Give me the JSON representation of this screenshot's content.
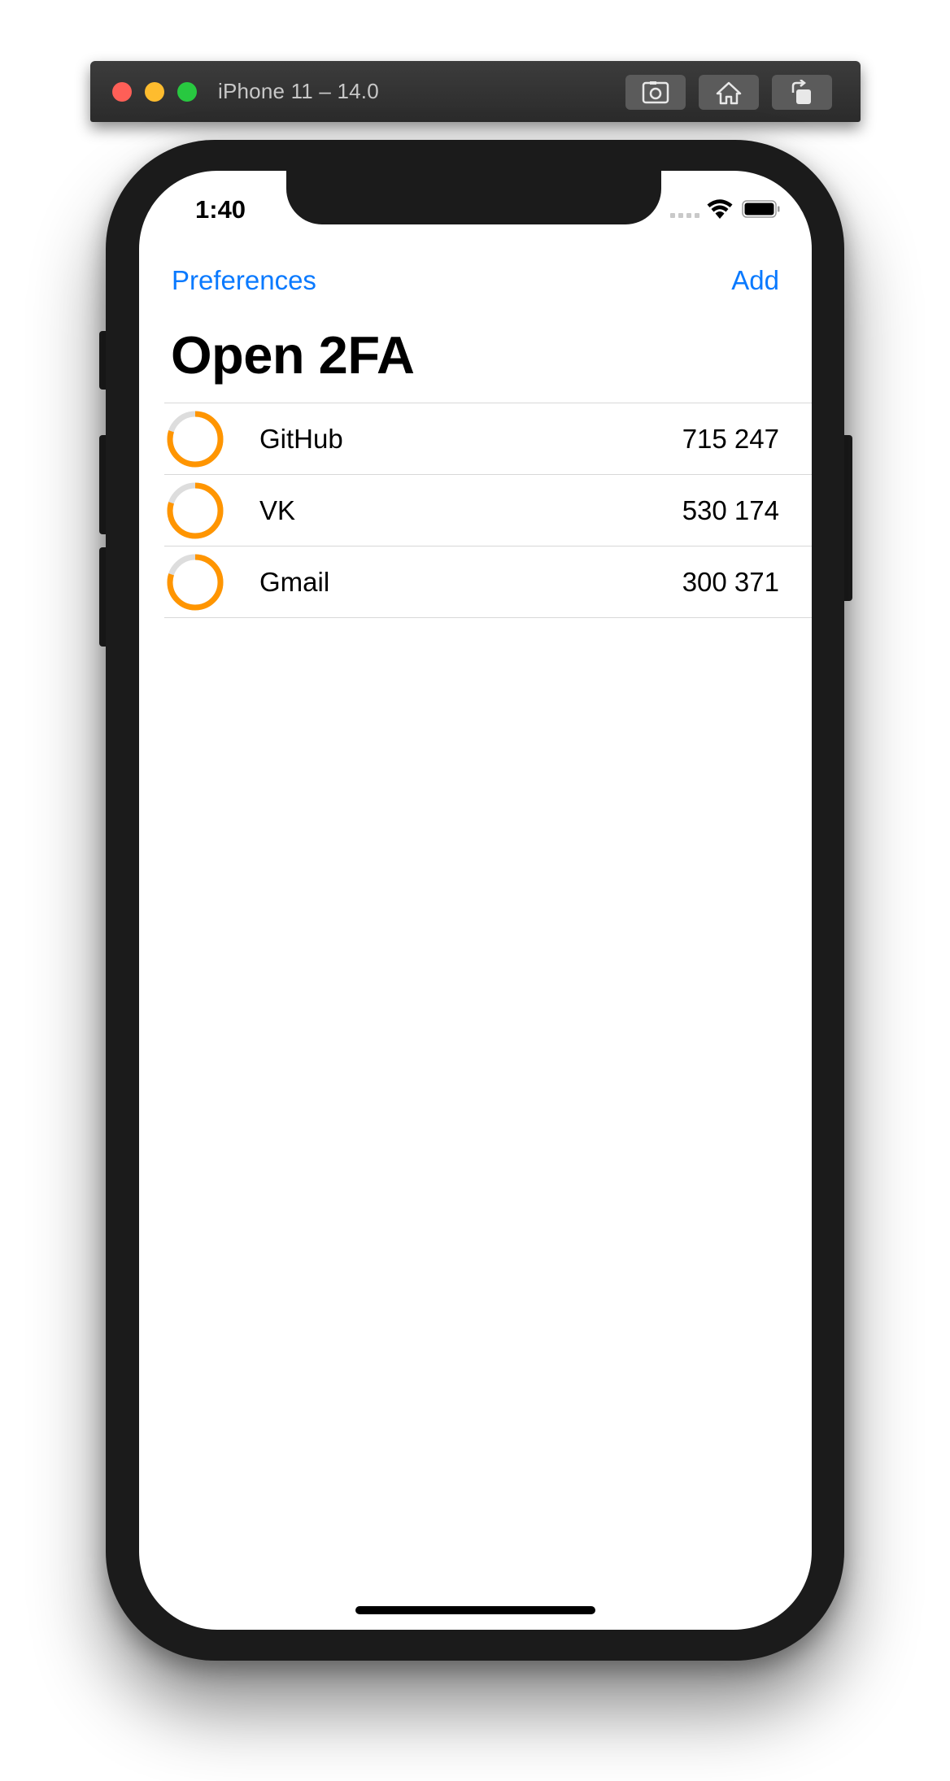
{
  "simulator": {
    "title": "iPhone 11 – 14.0",
    "buttons": [
      {
        "name": "screenshot",
        "icon": "camera-icon"
      },
      {
        "name": "home",
        "icon": "home-icon"
      },
      {
        "name": "rotate",
        "icon": "rotate-icon"
      }
    ]
  },
  "status_bar": {
    "time": "1:40",
    "battery_icon": "battery-full-icon",
    "wifi_icon": "wifi-icon"
  },
  "nav": {
    "left_button": "Preferences",
    "right_button": "Add",
    "title": "Open 2FA"
  },
  "accounts": [
    {
      "name": "GitHub",
      "code": "715 247",
      "remaining_fraction": 0.8
    },
    {
      "name": "VK",
      "code": "530 174",
      "remaining_fraction": 0.8
    },
    {
      "name": "Gmail",
      "code": "300 371",
      "remaining_fraction": 0.8
    }
  ],
  "colors": {
    "accent": "#0a7aff",
    "ring_progress": "#ff9500",
    "ring_track": "#dddddd"
  }
}
